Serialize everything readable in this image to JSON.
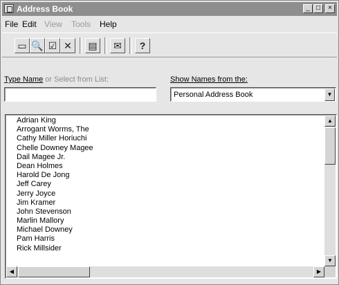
{
  "window": {
    "title": "Address Book",
    "controls": {
      "minimize": "_",
      "maximize": "□",
      "close": "×"
    }
  },
  "menu": [
    {
      "label": "File",
      "enabled": true
    },
    {
      "label": "Edit",
      "enabled": true
    },
    {
      "label": "View",
      "enabled": false
    },
    {
      "label": "Tools",
      "enabled": false
    },
    {
      "label": "Help",
      "enabled": true
    }
  ],
  "toolbar": {
    "buttons": [
      {
        "icon": "new-entry-icon",
        "glyph": "▭"
      },
      {
        "icon": "find-icon",
        "glyph": "🔍"
      },
      {
        "icon": "properties-icon",
        "glyph": "☑"
      },
      {
        "icon": "delete-icon",
        "glyph": "✕"
      },
      {
        "icon": "personal-address-book-icon",
        "glyph": "▤"
      },
      {
        "icon": "add-to-address-book-icon",
        "glyph": "✉"
      },
      {
        "icon": "help-icon",
        "glyph": "?"
      }
    ]
  },
  "name_field": {
    "label_type": "Type Name",
    "label_rest": " or Select from List:",
    "value": ""
  },
  "source_select": {
    "label": "Show Names from the:",
    "value": "Personal Address Book"
  },
  "names": [
    "Adrian King",
    "Arrogant Worms, The",
    "Cathy Miller Horiuchi",
    "Chelle Downey Magee",
    "Dail Magee Jr.",
    "Dean Holmes",
    "Harold De Jong",
    "Jeff Carey",
    "Jerry Joyce",
    "Jim Kramer",
    "John Stevenson",
    "Marlin Mallory",
    "Michael Downey",
    "Pam Harris",
    "Rick Millsider"
  ],
  "scrollbar": {
    "up": "▲",
    "down": "▼",
    "left": "◀",
    "right": "▶"
  }
}
